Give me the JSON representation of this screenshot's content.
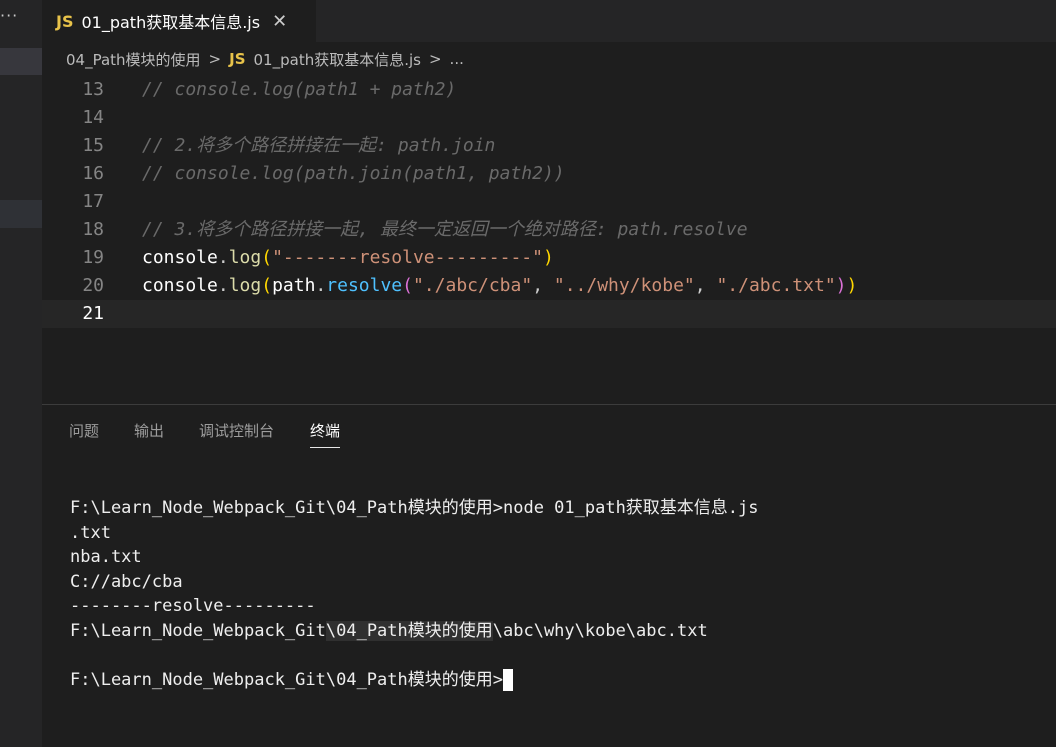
{
  "tab": {
    "badge": "JS",
    "title": "01_path获取基本信息.js",
    "close": "✕"
  },
  "activity": {
    "more": "···"
  },
  "breadcrumb": {
    "folder": "04_Path模块的使用",
    "sep1": ">",
    "badge": "JS",
    "file": "01_path获取基本信息.js",
    "sep2": ">",
    "more": "..."
  },
  "editor": {
    "lines": [
      {
        "number": "13",
        "comment": "// console.log(path1 + path2)"
      },
      {
        "number": "14"
      },
      {
        "number": "15",
        "comment": "// 2.将多个路径拼接在一起: path.join"
      },
      {
        "number": "16",
        "comment": "// console.log(path.join(path1, path2))"
      },
      {
        "number": "17"
      },
      {
        "number": "18",
        "comment": "// 3.将多个路径拼接一起, 最终一定返回一个绝对路径: path.resolve"
      },
      {
        "number": "19",
        "tokens": {
          "obj": "console",
          "dot": ".",
          "fn": "log",
          "open": "(",
          "str": "\"-------resolve---------\"",
          "close": ")"
        }
      },
      {
        "number": "20",
        "tokens": {
          "obj": "console",
          "dot": ".",
          "fn": "log",
          "open1": "(",
          "obj2": "path",
          "dot2": ".",
          "fn2": "resolve",
          "open2": "(",
          "s1": "\"./abc/cba\"",
          "c1": ", ",
          "s2": "\"../why/kobe\"",
          "c2": ", ",
          "s3": "\"./abc.txt\"",
          "close2": ")",
          "close1": ")"
        }
      },
      {
        "number": "21"
      }
    ]
  },
  "panel": {
    "tabs": [
      "问题",
      "输出",
      "调试控制台",
      "终端"
    ],
    "active": "终端"
  },
  "terminal": {
    "line1": "F:\\Learn_Node_Webpack_Git\\04_Path模块的使用>node 01_path获取基本信息.js",
    "line2": ".txt",
    "line3": "nba.txt",
    "line4": "C://abc/cba",
    "line5": "--------resolve---------",
    "line6a": "F:\\Learn_Node_Webpack_Git",
    "line6b": "\\04_Path模块的使用",
    "line6c": "\\abc\\why\\kobe\\abc.txt",
    "prompt": "F:\\Learn_Node_Webpack_Git\\04_Path模块的使用>"
  }
}
